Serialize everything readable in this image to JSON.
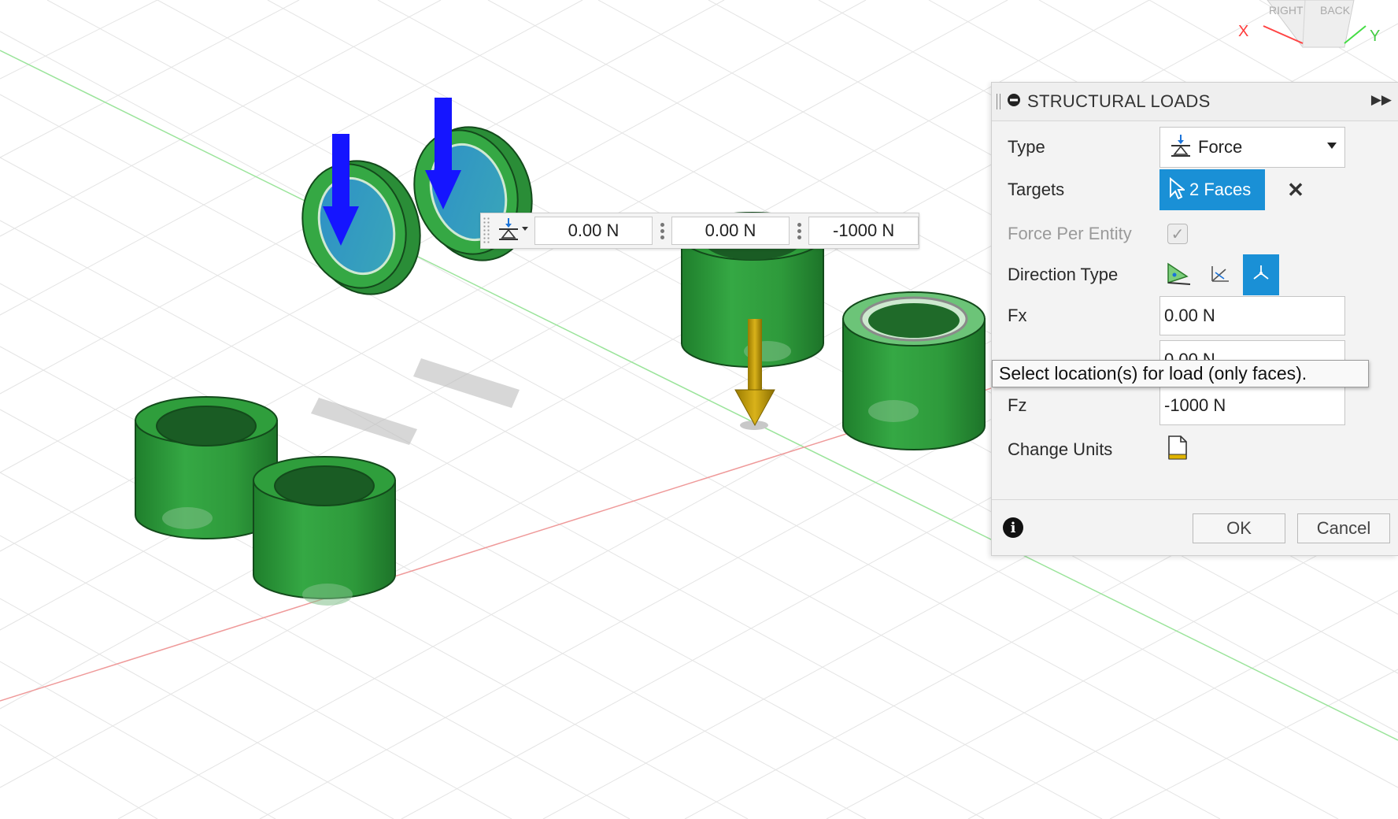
{
  "viewport": {
    "label": "3D viewport",
    "view_cube": {
      "faces": [
        "RIGHT",
        "BACK"
      ],
      "axes": [
        "X",
        "Y"
      ]
    }
  },
  "inline_toolbar": {
    "load_type_icon": "force-icon",
    "fx_value": "0.00 N",
    "fy_value": "0.00 N",
    "fz_value": "-1000 N"
  },
  "panel": {
    "title": "STRUCTURAL LOADS",
    "type_label": "Type",
    "type_value": "Force",
    "targets_label": "Targets",
    "targets_value": "2 Faces",
    "force_per_entity_label": "Force Per Entity",
    "force_per_entity_checked": true,
    "direction_type_label": "Direction Type",
    "direction_options": [
      "angle-icon",
      "vector-icon",
      "components-icon"
    ],
    "direction_selected": "components-icon",
    "fx_label": "Fx",
    "fx_value": "0.00 N",
    "fy_value": "0.00 N",
    "fz_label": "Fz",
    "fz_value": "-1000 N",
    "change_units_label": "Change Units",
    "ok_label": "OK",
    "cancel_label": "Cancel"
  },
  "tooltip": {
    "text": "Select location(s) for load (only faces)."
  },
  "colors": {
    "accent": "#1a90d6",
    "part_green": "#2f9e3c",
    "load_arrow_blue": "#1a1aff",
    "load_arrow_gold": "#c9a000",
    "axis_red": "#e88888",
    "axis_green": "#9be49b"
  }
}
